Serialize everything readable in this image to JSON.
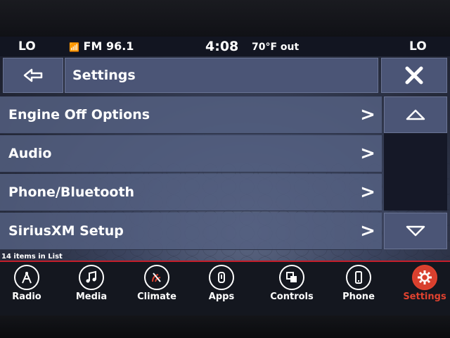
{
  "status": {
    "left_climate": "LO",
    "radio": "FM 96.1",
    "time": "4:08",
    "outside_temp": "70°F out",
    "right_climate": "LO"
  },
  "header": {
    "back_icon": "back-arrow-icon",
    "title": "Settings",
    "close_icon": "close-icon"
  },
  "list": {
    "items": [
      {
        "label": "Engine Off Options",
        "chevron": ">"
      },
      {
        "label": "Audio",
        "chevron": ">"
      },
      {
        "label": "Phone/Bluetooth",
        "chevron": ">"
      },
      {
        "label": "SiriusXM Setup",
        "chevron": ">"
      }
    ],
    "count_text": "14 items in List"
  },
  "scroll": {
    "up_icon": "chevron-up-icon",
    "down_icon": "chevron-down-icon"
  },
  "dock": {
    "items": [
      {
        "label": "Radio",
        "icon": "radio-icon"
      },
      {
        "label": "Media",
        "icon": "music-note-icon"
      },
      {
        "label": "Climate",
        "icon": "climate-icon"
      },
      {
        "label": "Apps",
        "icon": "apps-icon"
      },
      {
        "label": "Controls",
        "icon": "controls-icon"
      },
      {
        "label": "Phone",
        "icon": "phone-icon"
      },
      {
        "label": "Settings",
        "icon": "gear-icon"
      }
    ],
    "active": "Settings",
    "accent_color": "#d8402e"
  }
}
